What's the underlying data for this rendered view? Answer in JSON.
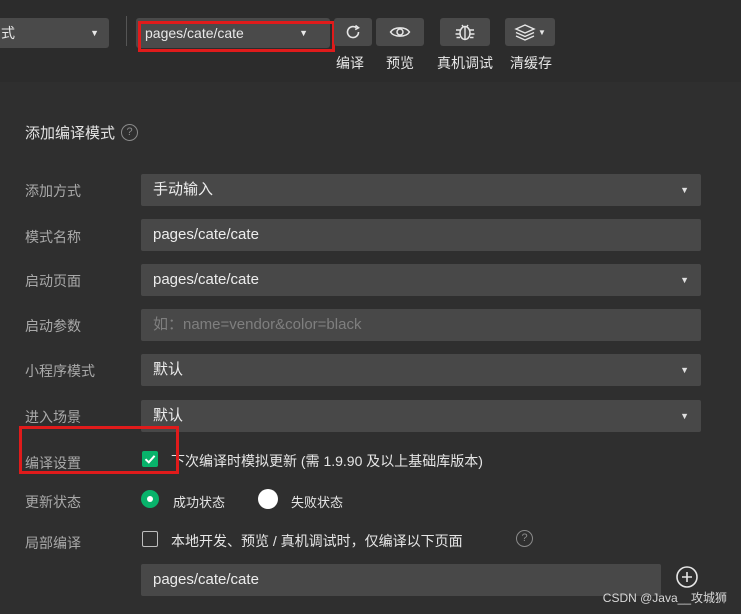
{
  "toolbar": {
    "mode_select_value": "式",
    "page_select_value": "pages/cate/cate",
    "compile_label": "编译",
    "preview_label": "预览",
    "debug_label": "真机调试",
    "cache_label": "清缓存"
  },
  "form": {
    "title": "添加编译模式",
    "add_method": {
      "label": "添加方式",
      "value": "手动输入"
    },
    "mode_name": {
      "label": "模式名称",
      "value": "pages/cate/cate"
    },
    "start_page": {
      "label": "启动页面",
      "value": "pages/cate/cate"
    },
    "start_params": {
      "label": "启动参数",
      "placeholder": "如：name=vendor&color=black"
    },
    "mini_mode": {
      "label": "小程序模式",
      "value": "默认"
    },
    "scene": {
      "label": "进入场景",
      "value": "默认"
    },
    "compile_settings": {
      "label": "编译设置",
      "checkbox_text": "下次编译时模拟更新 (需 1.9.90 及以上基础库版本)",
      "checked": true
    },
    "update_status": {
      "label": "更新状态",
      "option_success": "成功状态",
      "option_fail": "失败状态",
      "selected": "成功状态"
    },
    "partial_compile": {
      "label": "局部编译",
      "checkbox_text": "本地开发、预览 / 真机调试时，仅编译以下页面",
      "checked": false,
      "page_value": "pages/cate/cate"
    }
  },
  "watermark": "CSDN @Java__攻城狮",
  "colors": {
    "accent": "#08b36b",
    "highlight": "#e01b1b",
    "background": "#2f2f2f",
    "field": "#484848"
  }
}
